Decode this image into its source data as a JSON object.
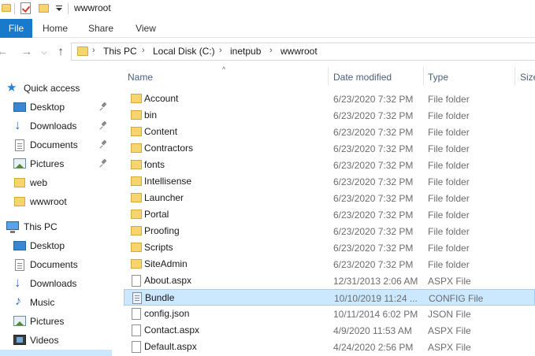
{
  "window": {
    "title": "wwwroot"
  },
  "ribbon": {
    "tabs": [
      "File",
      "Home",
      "Share",
      "View"
    ]
  },
  "address": {
    "crumbs": [
      "This PC",
      "Local Disk (C:)",
      "inetpub",
      "wwwroot"
    ]
  },
  "nav": {
    "quick_access": {
      "label": "Quick access",
      "icon": "star-icon"
    },
    "quick_items": [
      {
        "label": "Desktop",
        "icon": "desktop-icon",
        "pinned": true
      },
      {
        "label": "Downloads",
        "icon": "download-icon",
        "pinned": true
      },
      {
        "label": "Documents",
        "icon": "document-icon",
        "pinned": true
      },
      {
        "label": "Pictures",
        "icon": "pictures-icon",
        "pinned": true
      },
      {
        "label": "web",
        "icon": "folder-icon",
        "pinned": false
      },
      {
        "label": "wwwroot",
        "icon": "folder-icon",
        "pinned": false
      }
    ],
    "this_pc": {
      "label": "This PC",
      "icon": "computer-icon"
    },
    "pc_items": [
      {
        "label": "Desktop",
        "icon": "desktop-icon"
      },
      {
        "label": "Documents",
        "icon": "document-icon"
      },
      {
        "label": "Downloads",
        "icon": "download-icon"
      },
      {
        "label": "Music",
        "icon": "music-icon"
      },
      {
        "label": "Pictures",
        "icon": "pictures-icon"
      },
      {
        "label": "Videos",
        "icon": "video-icon"
      }
    ]
  },
  "columns": {
    "name": "Name",
    "date": "Date modified",
    "type": "Type",
    "size": "Size"
  },
  "files": [
    {
      "name": "Account",
      "date": "6/23/2020 7:32 PM",
      "type": "File folder",
      "kind": "folder"
    },
    {
      "name": "bin",
      "date": "6/23/2020 7:32 PM",
      "type": "File folder",
      "kind": "folder"
    },
    {
      "name": "Content",
      "date": "6/23/2020 7:32 PM",
      "type": "File folder",
      "kind": "folder"
    },
    {
      "name": "Contractors",
      "date": "6/23/2020 7:32 PM",
      "type": "File folder",
      "kind": "folder"
    },
    {
      "name": "fonts",
      "date": "6/23/2020 7:32 PM",
      "type": "File folder",
      "kind": "folder"
    },
    {
      "name": "Intellisense",
      "date": "6/23/2020 7:32 PM",
      "type": "File folder",
      "kind": "folder"
    },
    {
      "name": "Launcher",
      "date": "6/23/2020 7:32 PM",
      "type": "File folder",
      "kind": "folder"
    },
    {
      "name": "Portal",
      "date": "6/23/2020 7:32 PM",
      "type": "File folder",
      "kind": "folder"
    },
    {
      "name": "Proofing",
      "date": "6/23/2020 7:32 PM",
      "type": "File folder",
      "kind": "folder"
    },
    {
      "name": "Scripts",
      "date": "6/23/2020 7:32 PM",
      "type": "File folder",
      "kind": "folder"
    },
    {
      "name": "SiteAdmin",
      "date": "6/23/2020 7:32 PM",
      "type": "File folder",
      "kind": "folder"
    },
    {
      "name": "About.aspx",
      "date": "12/31/2013 2:06 AM",
      "type": "ASPX File",
      "kind": "file"
    },
    {
      "name": "Bundle",
      "date": "10/10/2019 11:24 ...",
      "type": "CONFIG File",
      "kind": "config",
      "selected": true
    },
    {
      "name": "config.json",
      "date": "10/11/2014 6:02 PM",
      "type": "JSON File",
      "kind": "file"
    },
    {
      "name": "Contact.aspx",
      "date": "4/9/2020 11:53 AM",
      "type": "ASPX File",
      "kind": "file"
    },
    {
      "name": "Default.aspx",
      "date": "4/24/2020 2:56 PM",
      "type": "ASPX File",
      "kind": "file"
    }
  ],
  "colors": {
    "accent": "#1979ca",
    "selection": "#cce8ff",
    "folder": "#f6d56e"
  }
}
